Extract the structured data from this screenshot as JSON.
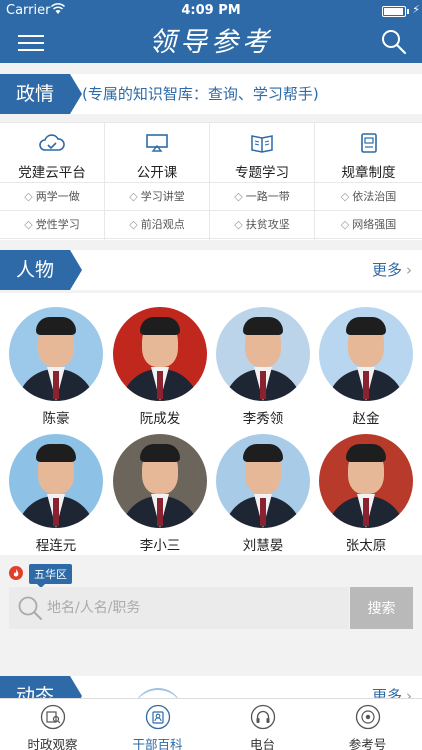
{
  "status_bar": {
    "carrier": "Carrier",
    "time": "4:09 PM"
  },
  "header": {
    "logo_text": "领导参考",
    "menu_icon": "menu-icon",
    "search_icon": "search-icon"
  },
  "politics": {
    "tag": "政情",
    "subtitle": "(专属的知识智库：查询、学习帮手)",
    "categories": [
      {
        "title": "党建云平台",
        "icon": "cloud-check-icon",
        "items": [
          "两学一做",
          "党性学习"
        ]
      },
      {
        "title": "公开课",
        "icon": "screen-icon",
        "items": [
          "学习讲堂",
          "前沿观点"
        ]
      },
      {
        "title": "专题学习",
        "icon": "open-book-icon",
        "items": [
          "一路一带",
          "扶贫攻坚"
        ]
      },
      {
        "title": "规章制度",
        "icon": "document-icon",
        "items": [
          "依法治国",
          "网络强国"
        ]
      }
    ]
  },
  "people": {
    "tag": "人物",
    "more": "更多",
    "list": [
      {
        "name": "陈豪",
        "bg": "#9cc8ea"
      },
      {
        "name": "阮成发",
        "bg": "#c0281e"
      },
      {
        "name": "李秀领",
        "bg": "#bcd4ea"
      },
      {
        "name": "赵金",
        "bg": "#b8d6ef"
      },
      {
        "name": "程连元",
        "bg": "#8dc1e6"
      },
      {
        "name": "李小三",
        "bg": "#6b655c"
      },
      {
        "name": "刘慧晏",
        "bg": "#a8cbe8"
      },
      {
        "name": "张太原",
        "bg": "#b83a2a"
      }
    ]
  },
  "district": {
    "badge": "五华区"
  },
  "search": {
    "placeholder": "地名/人名/职务",
    "button": "搜索"
  },
  "next_section": {
    "tag": "动态",
    "more": "更多"
  },
  "tabs": [
    {
      "label": "时政观察",
      "icon": "news-search-icon",
      "active": false
    },
    {
      "label": "干部百科",
      "icon": "encyclopedia-icon",
      "active": true
    },
    {
      "label": "电台",
      "icon": "headphones-icon",
      "active": false
    },
    {
      "label": "参考号",
      "icon": "target-icon",
      "active": false
    }
  ],
  "colors": {
    "primary": "#2d6aa7",
    "background": "#f2f2f2",
    "search_button": "#b9b9b9"
  }
}
